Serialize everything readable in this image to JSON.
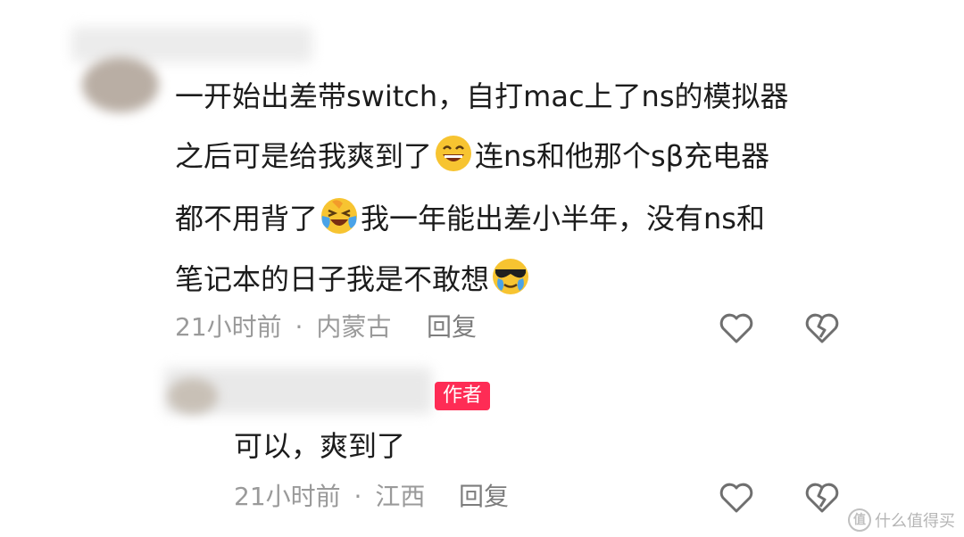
{
  "comment": {
    "lines": [
      "一开始出差带switch，自打mac上了ns的模拟器",
      "之后可是给我爽到了",
      "连ns和他那个sβ充电器",
      "都不用背了",
      "我一年能出差小半年，没有ns和",
      "笔记本的日子我是不敢想"
    ],
    "emojis": [
      "grinning-face-icon",
      "laughing-crying-face-icon",
      "sunglasses-crying-face-icon"
    ],
    "time": "21小时前",
    "separator": "·",
    "location": "内蒙古",
    "reply_label": "回复"
  },
  "reply": {
    "author_badge": "作者",
    "text": "可以，爽到了",
    "time": "21小时前",
    "separator": "·",
    "location": "江西",
    "reply_label": "回复"
  },
  "watermark": {
    "logo": "值",
    "text": "什么值得买"
  },
  "colors": {
    "accent": "#fe2c55",
    "meta": "#9a9a9a",
    "icon": "#6f6f6f"
  }
}
